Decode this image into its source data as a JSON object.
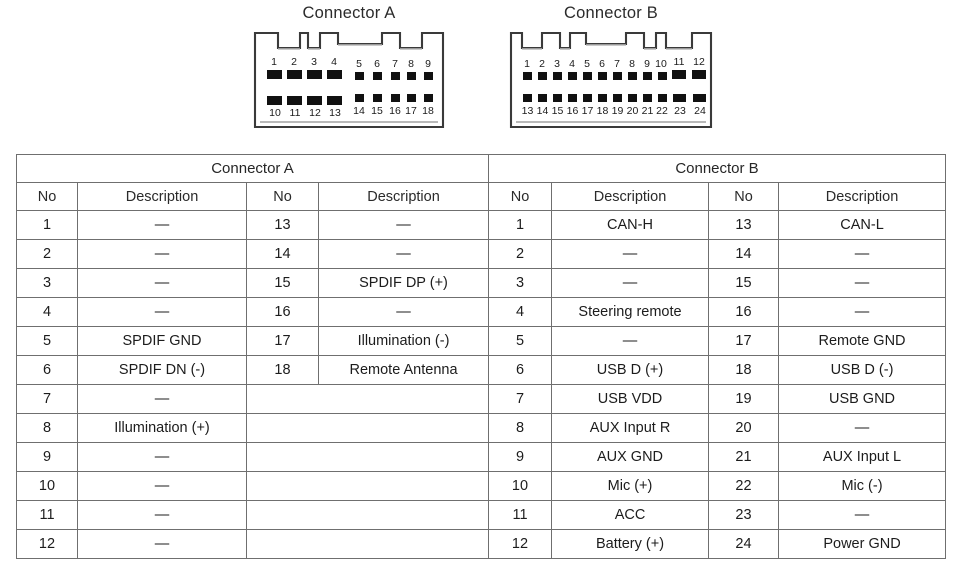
{
  "diagrams": [
    {
      "title": "Connector A",
      "rows": [
        {
          "labels": [
            "1",
            "2",
            "3",
            "4"
          ],
          "variant": "large-left-top"
        },
        {
          "labels": [
            "5",
            "6",
            "7",
            "8",
            "9"
          ],
          "variant": "small-right-top"
        },
        {
          "labels": [
            "10",
            "11",
            "12",
            "13"
          ],
          "variant": "large-left-bottom"
        },
        {
          "labels": [
            "14",
            "15",
            "16",
            "17",
            "18"
          ],
          "variant": "small-right-bottom"
        }
      ]
    },
    {
      "title": "Connector B",
      "rows": [
        {
          "labels": [
            "1",
            "2",
            "3",
            "4",
            "5",
            "6",
            "7",
            "8",
            "9",
            "10"
          ],
          "variant": "small-left-top"
        },
        {
          "labels": [
            "11",
            "12"
          ],
          "variant": "large-right-top"
        },
        {
          "labels": [
            "13",
            "14",
            "15",
            "16",
            "17",
            "18",
            "19",
            "20",
            "21",
            "22"
          ],
          "variant": "small-left-bottom"
        },
        {
          "labels": [
            "23",
            "24"
          ],
          "variant": "large-right-bottom"
        }
      ]
    }
  ],
  "table": {
    "groups": [
      {
        "label": "Connector A"
      },
      {
        "label": "Connector B"
      }
    ],
    "column_headers": [
      "No",
      "Description",
      "No",
      "Description",
      "No",
      "Description",
      "No",
      "Description"
    ],
    "dash": "—",
    "connector_a": {
      "left": [
        {
          "no": "1",
          "desc": "—"
        },
        {
          "no": "2",
          "desc": "—"
        },
        {
          "no": "3",
          "desc": "—"
        },
        {
          "no": "4",
          "desc": "—"
        },
        {
          "no": "5",
          "desc": "SPDIF GND"
        },
        {
          "no": "6",
          "desc": "SPDIF DN (-)"
        },
        {
          "no": "7",
          "desc": "—"
        },
        {
          "no": "8",
          "desc": "Illumination (+)"
        },
        {
          "no": "9",
          "desc": "—"
        },
        {
          "no": "10",
          "desc": "—"
        },
        {
          "no": "11",
          "desc": "—"
        },
        {
          "no": "12",
          "desc": "—"
        }
      ],
      "right": [
        {
          "no": "13",
          "desc": "—"
        },
        {
          "no": "14",
          "desc": "—"
        },
        {
          "no": "15",
          "desc": "SPDIF DP (+)"
        },
        {
          "no": "16",
          "desc": "—"
        },
        {
          "no": "17",
          "desc": "Illumination (-)"
        },
        {
          "no": "18",
          "desc": "Remote Antenna"
        },
        {
          "no": "",
          "desc": ""
        },
        {
          "no": "",
          "desc": ""
        },
        {
          "no": "",
          "desc": ""
        },
        {
          "no": "",
          "desc": ""
        },
        {
          "no": "",
          "desc": ""
        },
        {
          "no": "",
          "desc": ""
        }
      ]
    },
    "connector_b": {
      "left": [
        {
          "no": "1",
          "desc": "CAN-H"
        },
        {
          "no": "2",
          "desc": "—"
        },
        {
          "no": "3",
          "desc": "—"
        },
        {
          "no": "4",
          "desc": "Steering remote"
        },
        {
          "no": "5",
          "desc": "—"
        },
        {
          "no": "6",
          "desc": "USB D (+)"
        },
        {
          "no": "7",
          "desc": "USB VDD"
        },
        {
          "no": "8",
          "desc": "AUX Input R"
        },
        {
          "no": "9",
          "desc": "AUX GND"
        },
        {
          "no": "10",
          "desc": "Mic (+)"
        },
        {
          "no": "11",
          "desc": "ACC"
        },
        {
          "no": "12",
          "desc": "Battery (+)"
        }
      ],
      "right": [
        {
          "no": "13",
          "desc": "CAN-L"
        },
        {
          "no": "14",
          "desc": "—"
        },
        {
          "no": "15",
          "desc": "—"
        },
        {
          "no": "16",
          "desc": "—"
        },
        {
          "no": "17",
          "desc": "Remote GND"
        },
        {
          "no": "18",
          "desc": "USB D (-)"
        },
        {
          "no": "19",
          "desc": "USB GND"
        },
        {
          "no": "20",
          "desc": "—"
        },
        {
          "no": "21",
          "desc": "AUX Input L"
        },
        {
          "no": "22",
          "desc": "Mic (-)"
        },
        {
          "no": "23",
          "desc": "—"
        },
        {
          "no": "24",
          "desc": "Power GND"
        }
      ]
    }
  },
  "colors": {
    "border": "#6f6f6f",
    "pin": "#111111",
    "shell_stroke": "#3a3a3a",
    "shell_fill": "#ffffff",
    "shell_shadow": "#b9b9b9"
  }
}
